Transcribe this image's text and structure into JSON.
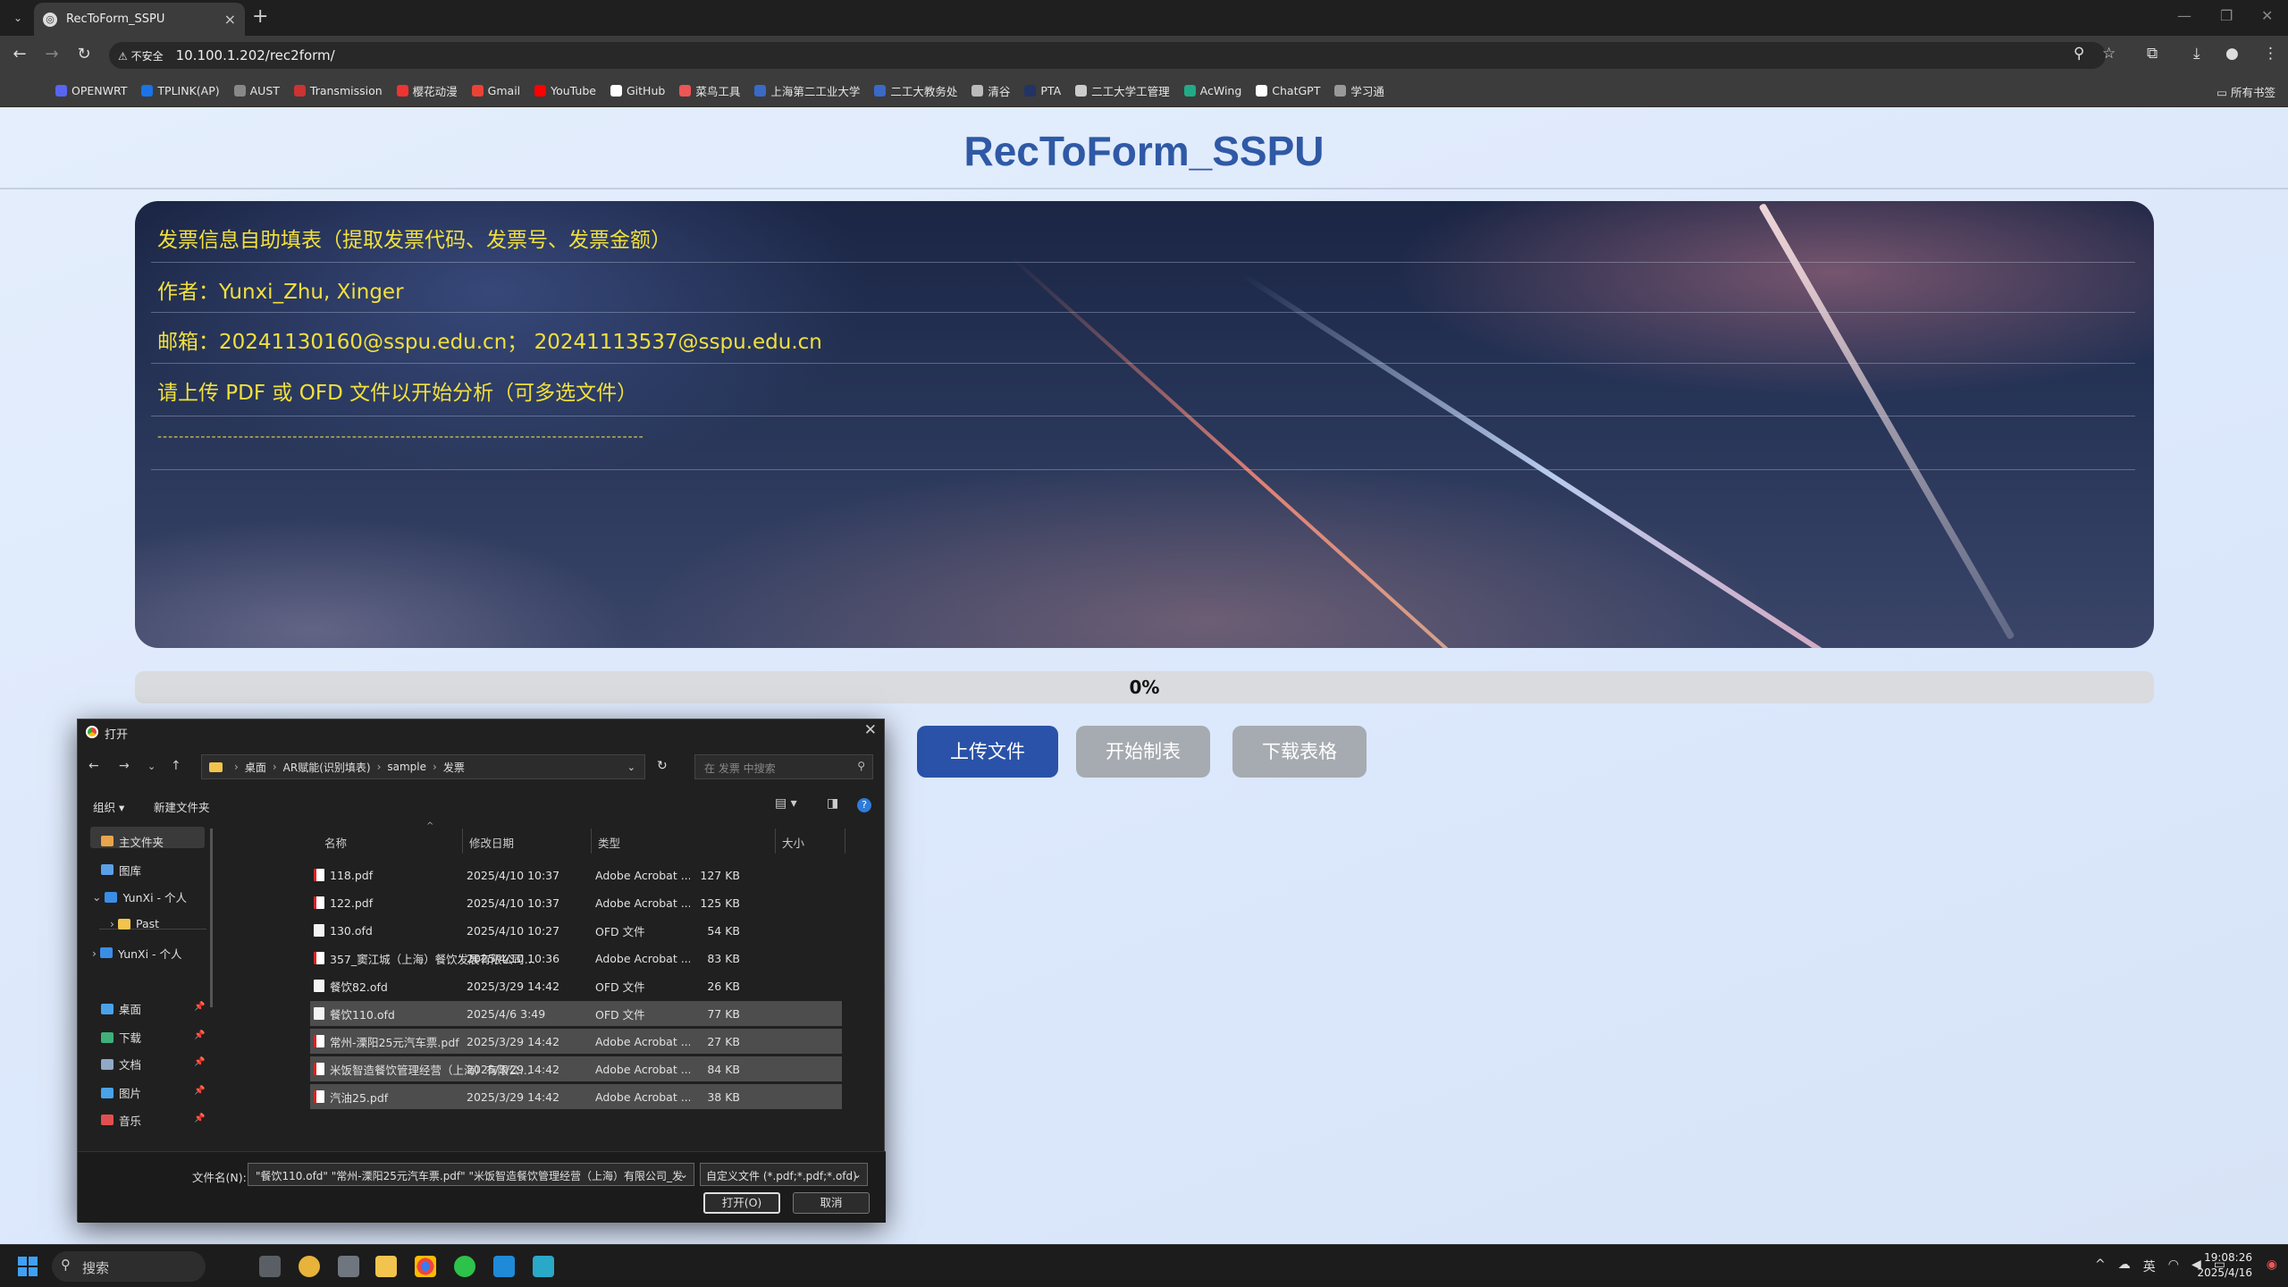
{
  "browser": {
    "tab_title": "RecToForm_SSPU",
    "security_label": "不安全",
    "url": "10.100.1.202/rec2form/",
    "bookmarks": [
      "OPENWRT",
      "TPLINK(AP)",
      "AUST",
      "Transmission",
      "樱花动漫",
      "Gmail",
      "YouTube",
      "GitHub",
      "菜鸟工具",
      "上海第二工业大学",
      "二工大教务处",
      "清谷",
      "PTA",
      "二工大学工管理",
      "AcWing",
      "ChatGPT",
      "学习通"
    ],
    "all_bookmarks": "所有书签"
  },
  "page": {
    "title": "RecToForm_SSPU",
    "info_lines": [
      "发票信息自助填表（提取发票代码、发票号、发票金额）",
      "作者：Yunxi_Zhu, Xinger",
      "邮箱：20241130160@sspu.edu.cn； 20241113537@sspu.edu.cn",
      "请上传 PDF 或 OFD 文件以开始分析（可多选文件）",
      "------------------------------------------------------------------------------------------"
    ],
    "progress_percent": 0,
    "progress_text": "0%",
    "buttons": {
      "upload": "上传文件",
      "make": "开始制表",
      "download": "下载表格"
    }
  },
  "dialog": {
    "title": "打开",
    "path": [
      "桌面",
      "AR赋能(识别填表)",
      "sample",
      "发票"
    ],
    "search_placeholder": "在 发票 中搜索",
    "organize": "组织 ▾",
    "new_folder": "新建文件夹",
    "sidebar": [
      {
        "label": "主文件夹",
        "color": "#e8a54b"
      },
      {
        "label": "图库",
        "color": "#5aa0e6"
      },
      {
        "label": "YunXi - 个人",
        "color": "#3a8ee6"
      },
      {
        "label": "Past",
        "color": "#f2c44e"
      },
      {
        "label": "YunXi - 个人",
        "color": "#3a8ee6"
      },
      {
        "label": "桌面",
        "color": "#4aa3e8"
      },
      {
        "label": "下载",
        "color": "#3fb07a"
      },
      {
        "label": "文档",
        "color": "#8fa9c7"
      },
      {
        "label": "图片",
        "color": "#4aa3e8"
      },
      {
        "label": "音乐",
        "color": "#e05050"
      }
    ],
    "columns": {
      "name": "名称",
      "date": "修改日期",
      "type": "类型",
      "size": "大小"
    },
    "files": [
      {
        "name": "118.pdf",
        "date": "2025/4/10 10:37",
        "type": "Adobe Acrobat ...",
        "size": "127 KB",
        "kind": "pdf",
        "selected": false
      },
      {
        "name": "122.pdf",
        "date": "2025/4/10 10:37",
        "type": "Adobe Acrobat ...",
        "size": "125 KB",
        "kind": "pdf",
        "selected": false
      },
      {
        "name": "130.ofd",
        "date": "2025/4/10 10:27",
        "type": "OFD 文件",
        "size": "54 KB",
        "kind": "ofd",
        "selected": false
      },
      {
        "name": "357_窦江城（上海）餐饮发展有限公司_...",
        "date": "2025/4/10 10:36",
        "type": "Adobe Acrobat ...",
        "size": "83 KB",
        "kind": "pdf",
        "selected": false
      },
      {
        "name": "餐饮82.ofd",
        "date": "2025/3/29 14:42",
        "type": "OFD 文件",
        "size": "26 KB",
        "kind": "ofd",
        "selected": false
      },
      {
        "name": "餐饮110.ofd",
        "date": "2025/4/6 3:49",
        "type": "OFD 文件",
        "size": "77 KB",
        "kind": "ofd",
        "selected": true
      },
      {
        "name": "常州-溧阳25元汽车票.pdf",
        "date": "2025/3/29 14:42",
        "type": "Adobe Acrobat ...",
        "size": "27 KB",
        "kind": "pdf",
        "selected": true
      },
      {
        "name": "米饭智造餐饮管理经营（上海）有限公司...",
        "date": "2025/3/29 14:42",
        "type": "Adobe Acrobat ...",
        "size": "84 KB",
        "kind": "pdf",
        "selected": true
      },
      {
        "name": "汽油25.pdf",
        "date": "2025/3/29 14:42",
        "type": "Adobe Acrobat ...",
        "size": "38 KB",
        "kind": "pdf",
        "selected": true
      }
    ],
    "filename_label": "文件名(N):",
    "filename_value": "\"餐饮110.ofd\" \"常州-溧阳25元汽车票.pdf\" \"米饭智造餐饮管理经营（上海）有限公司_发",
    "filetype": "自定义文件 (*.pdf;*.pdf;*.ofd)",
    "open": "打开(O)",
    "cancel": "取消"
  },
  "taskbar": {
    "search": "搜索",
    "ime": "英",
    "time": "19:08:26",
    "date": "2025/4/16"
  }
}
